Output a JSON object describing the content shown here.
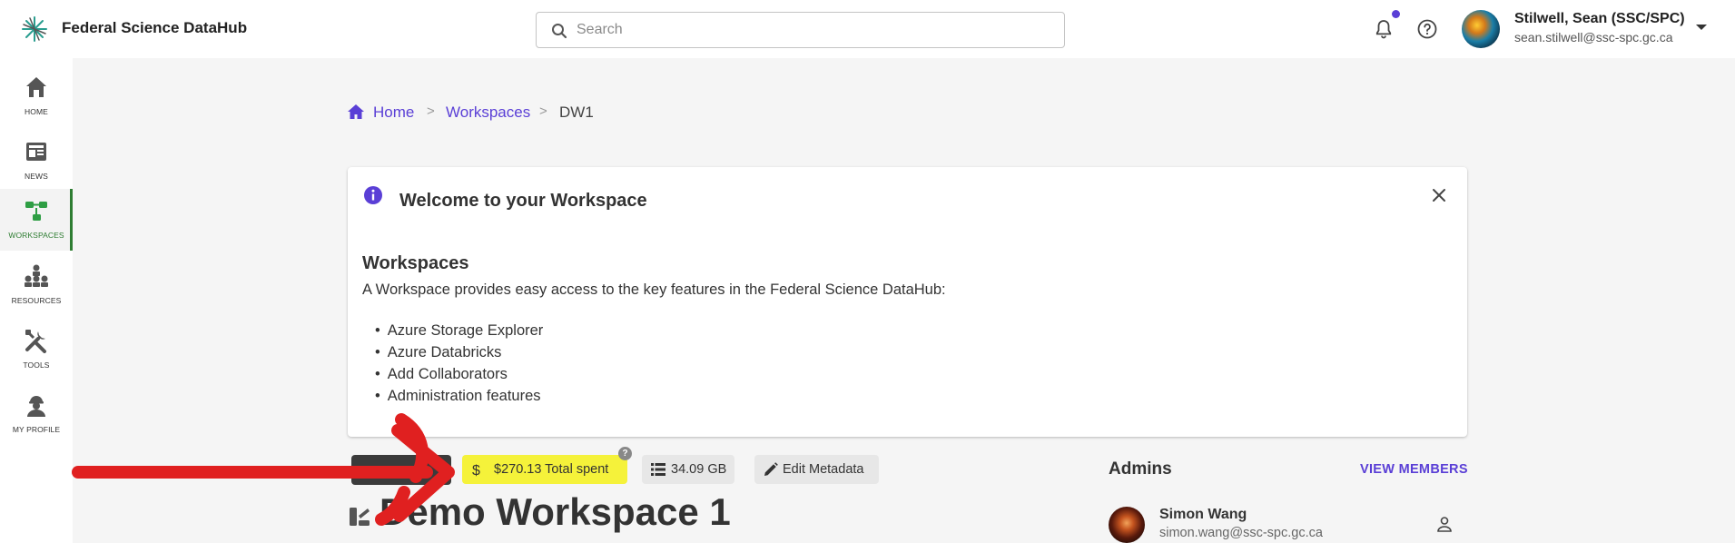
{
  "header": {
    "app_title": "Federal Science DataHub",
    "search_placeholder": "Search",
    "user_name": "Stilwell, Sean (SSC/SPC)",
    "user_email": "sean.stilwell@ssc-spc.gc.ca"
  },
  "sidebar": {
    "items": [
      {
        "label": "HOME",
        "icon": "home-icon"
      },
      {
        "label": "NEWS",
        "icon": "newspaper-icon"
      },
      {
        "label": "WORKSPACES",
        "icon": "workspaces-icon",
        "active": true
      },
      {
        "label": "RESOURCES",
        "icon": "resources-icon"
      },
      {
        "label": "TOOLS",
        "icon": "tools-icon"
      },
      {
        "label": "MY PROFILE",
        "icon": "profile-icon"
      }
    ]
  },
  "breadcrumb": {
    "home": "Home",
    "sep": ">",
    "workspaces": "Workspaces",
    "current": "DW1"
  },
  "welcome_card": {
    "title": "Welcome to your Workspace",
    "heading": "Workspaces",
    "description": "A Workspace provides easy access to the key features in the Federal Science DataHub:",
    "features": [
      "Azure Storage Explorer",
      "Azure Databricks",
      "Add Collaborators",
      "Administration features"
    ]
  },
  "workspace": {
    "spent_label": "$270.13 Total spent",
    "storage_label": "34.09 GB",
    "edit_metadata_label": "Edit Metadata",
    "help_glyph": "?",
    "title": "Demo Workspace 1"
  },
  "admins": {
    "title": "Admins",
    "view_members_label": "VIEW MEMBERS",
    "list": [
      {
        "name": "Simon Wang",
        "email": "simon.wang@ssc-spc.gc.ca"
      }
    ]
  },
  "colors": {
    "accent": "#5a3fd6",
    "active_nav": "#2e7d32",
    "highlight": "#f5f23a",
    "annotation_arrow": "#e02020"
  }
}
